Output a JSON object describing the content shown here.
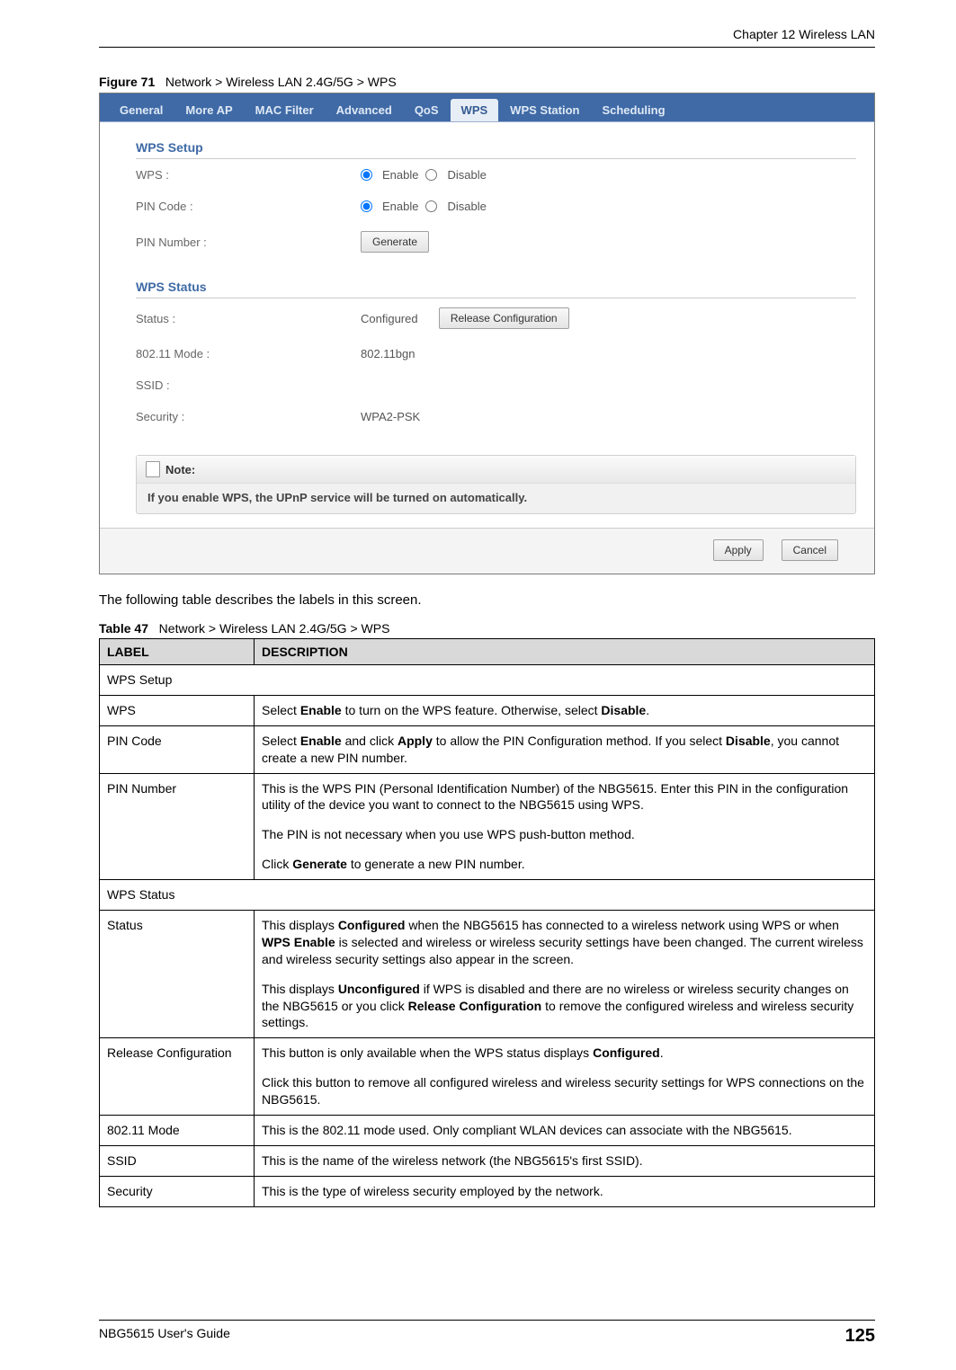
{
  "header": {
    "chapter": "Chapter 12 Wireless LAN"
  },
  "figure": {
    "prefix": "Figure 71",
    "title": "Network > Wireless LAN 2.4G/5G > WPS"
  },
  "tabs": {
    "items": [
      "General",
      "More AP",
      "MAC Filter",
      "Advanced",
      "QoS",
      "WPS",
      "WPS Station",
      "Scheduling"
    ],
    "active_index": 5
  },
  "wps_setup": {
    "heading": "WPS Setup",
    "wps_label": "WPS :",
    "pin_code_label": "PIN Code :",
    "pin_number_label": "PIN Number :",
    "enable": "Enable",
    "disable": "Disable",
    "generate_button": "Generate"
  },
  "wps_status": {
    "heading": "WPS Status",
    "status_label": "Status :",
    "status_value": "Configured",
    "release_button": "Release Configuration",
    "mode_label": "802.11 Mode :",
    "mode_value": "802.11bgn",
    "ssid_label": "SSID :",
    "ssid_value": "",
    "security_label": "Security :",
    "security_value": "WPA2-PSK"
  },
  "note": {
    "heading": "Note:",
    "text": "If you enable WPS, the UPnP service will be turned on automatically."
  },
  "actions": {
    "apply": "Apply",
    "cancel": "Cancel"
  },
  "intro": "The following table describes the labels in this screen.",
  "table_caption": {
    "prefix": "Table 47",
    "title": "Network > Wireless LAN 2.4G/5G > WPS"
  },
  "table_headers": {
    "label": "LABEL",
    "description": "DESCRIPTION"
  },
  "rows": {
    "r0": {
      "label": "WPS Setup"
    },
    "r1": {
      "label": "WPS",
      "d_a": "Select ",
      "d_b": "Enable",
      "d_c": " to turn on the WPS feature. Otherwise, select ",
      "d_d": "Disable",
      "d_e": "."
    },
    "r2": {
      "label": "PIN Code",
      "d_a": "Select ",
      "d_b": "Enable",
      "d_c": " and click ",
      "d_d": "Apply",
      "d_e": " to allow the PIN Configuration method. If you select ",
      "d_f": "Disable",
      "d_g": ", you cannot create a new PIN number."
    },
    "r3": {
      "label": "PIN Number",
      "p1": "This is the WPS PIN (Personal Identification Number) of the NBG5615. Enter this PIN in the configuration utility of the device you want to connect to the NBG5615 using WPS.",
      "p2": "The PIN is not necessary when you use WPS push-button method.",
      "p3_a": "Click ",
      "p3_b": "Generate",
      "p3_c": " to generate a new PIN number."
    },
    "r4": {
      "label": "WPS Status"
    },
    "r5": {
      "label": "Status",
      "p1_a": "This displays ",
      "p1_b": "Configured",
      "p1_c": " when the NBG5615 has connected to a wireless network using WPS or when ",
      "p1_d": "WPS Enable",
      "p1_e": " is selected and wireless or wireless security settings have been changed. The current wireless and wireless security settings also appear in the screen.",
      "p2_a": "This displays ",
      "p2_b": "Unconfigured",
      "p2_c": " if WPS is disabled and there are no wireless or wireless security changes on the NBG5615 or you click ",
      "p2_d": "Release Configuration",
      "p2_e": " to remove the configured wireless and wireless security settings."
    },
    "r6": {
      "label": "Release Configuration",
      "p1_a": "This button is only available when the WPS status displays ",
      "p1_b": "Configured",
      "p1_c": ".",
      "p2": "Click this button to remove all configured wireless and wireless security settings for WPS connections on the NBG5615."
    },
    "r7": {
      "label": "802.11 Mode",
      "desc": "This is the 802.11 mode used. Only compliant WLAN devices can associate with the NBG5615."
    },
    "r8": {
      "label": "SSID",
      "desc": "This is the name of the wireless network (the NBG5615's first SSID)."
    },
    "r9": {
      "label": "Security",
      "desc": "This is the type of wireless security employed by the network."
    }
  },
  "footer": {
    "guide": "NBG5615 User's Guide",
    "page": "125"
  }
}
